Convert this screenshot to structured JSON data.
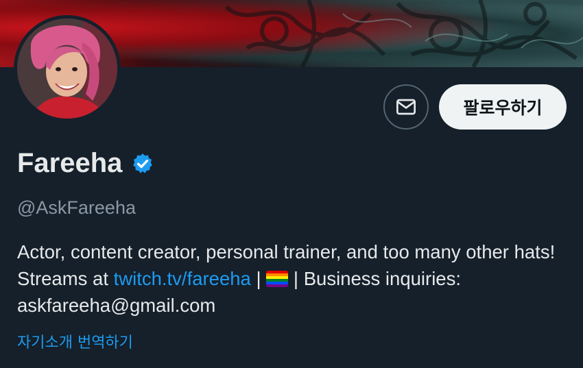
{
  "profile": {
    "display_name": "Fareeha",
    "handle": "@AskFareeha",
    "bio": {
      "part1": "Actor, content creator, personal trainer, and too many other hats! Streams at ",
      "link": "twitch.tv/fareeha",
      "sep1": " | ",
      "sep2": " | Business inquiries: askfareeha@gmail.com"
    },
    "translate_label": "자기소개 번역하기"
  },
  "actions": {
    "follow_label": "팔로우하기"
  },
  "icons": {
    "message": "envelope-icon",
    "verified": "verified-badge-icon",
    "flag": "rainbow-flag-icon"
  },
  "colors": {
    "background": "#15202b",
    "accent": "#1d9bf0",
    "follow_bg": "#eff3f4",
    "muted": "#8b98a5"
  }
}
